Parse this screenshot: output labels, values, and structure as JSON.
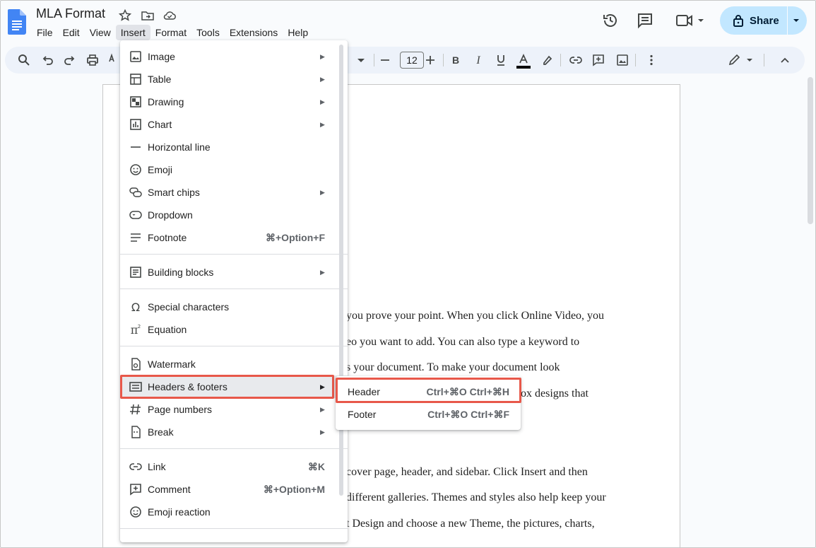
{
  "app": {
    "doc_title": "MLA Format",
    "menus": [
      "File",
      "Edit",
      "View",
      "Insert",
      "Format",
      "Tools",
      "Extensions",
      "Help"
    ],
    "active_menu": "Insert",
    "share_label": "Share"
  },
  "toolbar": {
    "font_size": "12"
  },
  "insert_menu": {
    "items": [
      {
        "label": "Image",
        "icon": "image-icon",
        "submenu": true
      },
      {
        "label": "Table",
        "icon": "table-icon",
        "submenu": true
      },
      {
        "label": "Drawing",
        "icon": "drawing-icon",
        "submenu": true
      },
      {
        "label": "Chart",
        "icon": "chart-icon",
        "submenu": true
      },
      {
        "label": "Horizontal line",
        "icon": "horizontal-line-icon",
        "submenu": false
      },
      {
        "label": "Emoji",
        "icon": "emoji-icon",
        "submenu": false
      },
      {
        "label": "Smart chips",
        "icon": "smart-chips-icon",
        "submenu": true
      },
      {
        "label": "Dropdown",
        "icon": "dropdown-icon",
        "submenu": false
      },
      {
        "label": "Footnote",
        "icon": "footnote-icon",
        "shortcut": "⌘+Option+F"
      },
      {
        "label": "Building blocks",
        "icon": "building-blocks-icon",
        "submenu": true
      },
      {
        "label": "Special characters",
        "icon": "omega-icon",
        "submenu": false
      },
      {
        "label": "Equation",
        "icon": "pi-icon",
        "submenu": false
      },
      {
        "label": "Watermark",
        "icon": "watermark-icon",
        "submenu": false
      },
      {
        "label": "Headers & footers",
        "icon": "headers-footers-icon",
        "submenu": true
      },
      {
        "label": "Page numbers",
        "icon": "hash-icon",
        "submenu": true
      },
      {
        "label": "Break",
        "icon": "break-icon",
        "submenu": true
      },
      {
        "label": "Link",
        "icon": "link-icon",
        "shortcut": "⌘K"
      },
      {
        "label": "Comment",
        "icon": "comment-icon",
        "shortcut": "⌘+Option+M"
      },
      {
        "label": "Emoji reaction",
        "icon": "emoji-reaction-icon",
        "submenu": false
      }
    ],
    "highlighted": "Headers & footers"
  },
  "submenu": {
    "items": [
      {
        "label": "Header",
        "shortcut": "Ctrl+⌘O Ctrl+⌘H"
      },
      {
        "label": "Footer",
        "shortcut": "Ctrl+⌘O Ctrl+⌘F"
      }
    ]
  },
  "document": {
    "lines": [
      "you prove your point. When you click Online Video, you",
      "eo you want to add. You can also type a keyword to",
      "s your document. To make your document look",
      "ox designs that",
      "cover page, header, and sidebar. Click Insert and then",
      "different galleries. Themes and styles also help keep your",
      "t Design and choose a new Theme, the pictures, charts,"
    ]
  }
}
